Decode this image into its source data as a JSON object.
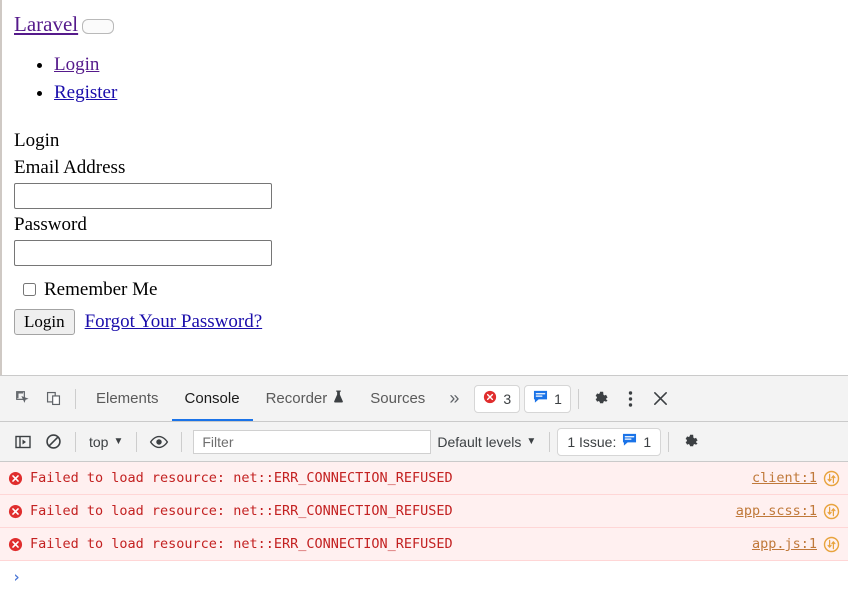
{
  "page": {
    "brand": "Laravel",
    "nav_items": [
      {
        "label": "Login",
        "state": "visited"
      },
      {
        "label": "Register",
        "state": "unvisited"
      }
    ],
    "form": {
      "heading": "Login",
      "email_label": "Email Address",
      "email_value": "",
      "password_label": "Password",
      "password_value": "",
      "remember_label": "Remember Me",
      "submit_label": "Login",
      "forgot_label": "Forgot Your Password?"
    }
  },
  "devtools": {
    "tabs": [
      {
        "label": "Elements",
        "active": false
      },
      {
        "label": "Console",
        "active": true
      },
      {
        "label": "Recorder",
        "active": false,
        "icon": "flask-icon"
      },
      {
        "label": "Sources",
        "active": false
      }
    ],
    "more_tabs_glyph": "»",
    "error_count": "3",
    "message_count": "1",
    "icons": {
      "inspect": "inspect-element-icon",
      "device": "device-toolbar-icon",
      "settings": "gear-icon",
      "more": "kebab-menu-icon",
      "close": "close-icon"
    },
    "toolbar": {
      "sidebar_toggle": "console-sidebar-icon",
      "clear_console": "clear-console-icon",
      "context": "top",
      "eye": "live-expression-icon",
      "filter_placeholder": "Filter",
      "filter_value": "",
      "levels": "Default levels",
      "issues_text": "1 Issue:",
      "issues_count": "1",
      "settings": "console-settings-icon"
    },
    "messages": [
      {
        "level": "error",
        "text": "Failed to load resource: net::ERR_CONNECTION_REFUSED",
        "source": "client:1"
      },
      {
        "level": "error",
        "text": "Failed to load resource: net::ERR_CONNECTION_REFUSED",
        "source": "app.scss:1"
      },
      {
        "level": "error",
        "text": "Failed to load resource: net::ERR_CONNECTION_REFUSED",
        "source": "app.js:1"
      }
    ],
    "prompt_glyph": "›"
  },
  "colors": {
    "error_red": "#c32121",
    "link_blue": "#1a0dab",
    "visited_purple": "#551a8b",
    "accent_blue": "#1a73e8",
    "network_orange": "#e8a33d"
  }
}
